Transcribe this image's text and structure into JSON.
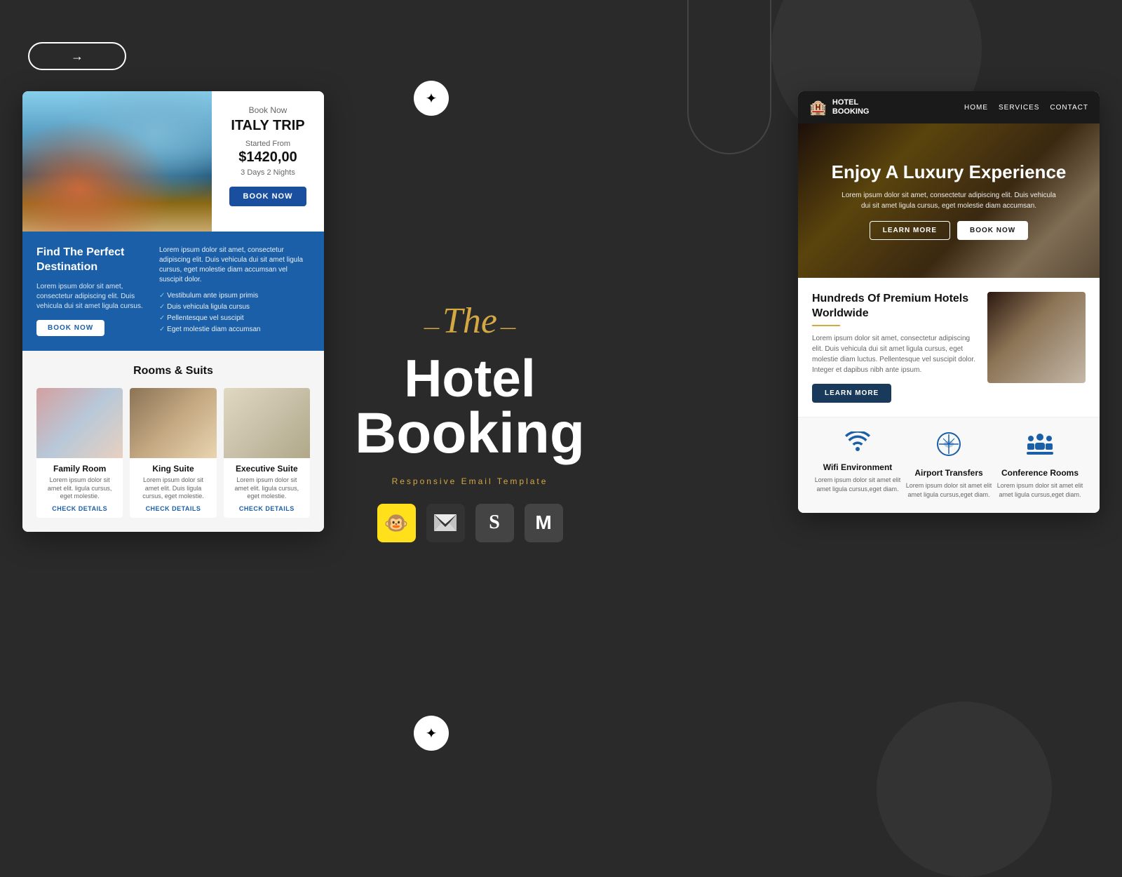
{
  "background": {
    "color": "#2a2a2a"
  },
  "arrow_button": {
    "label": "→"
  },
  "center": {
    "the_label": "The",
    "hotel_label": "Hotel",
    "booking_label": "Booking",
    "subtitle": "Responsive Email Template",
    "email_services": [
      "Mailchimp",
      "Campaign Monitor",
      "Stamplia",
      "Mailjet"
    ]
  },
  "left_card": {
    "hero": {
      "book_now_small": "Book Now",
      "trip_title": "ITALY TRIP",
      "started_from": "Started From",
      "price": "$1420,00",
      "duration": "3 Days 2 Nights",
      "book_btn": "BOOK NOW"
    },
    "blue_section": {
      "title": "Find The Perfect Destination",
      "desc": "Lorem ipsum dolor sit amet, consectetur adipiscing elit. Duis vehicula dui sit amet ligula cursus.",
      "book_btn": "BOOK NOW",
      "right_desc": "Lorem ipsum dolor sit amet, consectetur adipiscing elit. Duis vehicula dui sit amet ligula cursus, eget molestie diam accumsan vel suscipit dolor.",
      "checklist": [
        "Vestibulum ante ipsum primis",
        "Duis vehicula ligula cursus",
        "Pellentesque vel suscipit",
        "Eget molestie diam accumsan"
      ]
    },
    "rooms": {
      "title": "Rooms & Suits",
      "items": [
        {
          "name": "Family Room",
          "desc": "Lorem ipsum dolor sit amet elit. ligula cursus, eget molestie.",
          "link": "CHECK DETAILS"
        },
        {
          "name": "King Suite",
          "desc": "Lorem ipsum dolor sit amet elit. Duis ligula cursus, eget molestie.",
          "link": "CHECK DETAILS"
        },
        {
          "name": "Executive Suite",
          "desc": "Lorem ipsum dolor sit amet elit. ligula cursus, eget molestie.",
          "link": "CHECK DETAILS"
        }
      ]
    }
  },
  "right_card": {
    "header": {
      "logo_icon": "🏨",
      "logo_line1": "HOTEL",
      "logo_line2": "BOOKING",
      "nav": [
        "HOME",
        "SERVICES",
        "CONTACT"
      ]
    },
    "hero": {
      "title": "Enjoy A Luxury Experience",
      "desc": "Lorem ipsum dolor sit amet, consectetur adipiscing elit. Duis vehicula dui sit amet ligula cursus, eget molestie diam accumsan.",
      "btn_learn": "LEARN MORE",
      "btn_book": "BOOK NOW"
    },
    "hotels": {
      "title": "Hundreds Of Premium Hotels Worldwide",
      "desc": "Lorem ipsum dolor sit amet, consectetur adipiscing elit. Duis vehicula dui sit amet ligula cursus, eget molestie diam luctus. Pellentesque vel suscipit dolor. Integer et dapibus nibh ante ipsum.",
      "btn_learn": "LEARN MORE"
    },
    "amenities": [
      {
        "icon": "wifi",
        "name": "Wifi Environment",
        "desc": "Lorem ipsum dolor sit amet elit amet ligula cursus,eget diam."
      },
      {
        "icon": "globe",
        "name": "Airport Transfers",
        "desc": "Lorem ipsum dolor sit amet elit amet ligula cursus,eget diam."
      },
      {
        "icon": "conference",
        "name": "Conference Rooms",
        "desc": "Lorem ipsum dolor sit amet elit amet ligula cursus,eget diam."
      }
    ]
  }
}
